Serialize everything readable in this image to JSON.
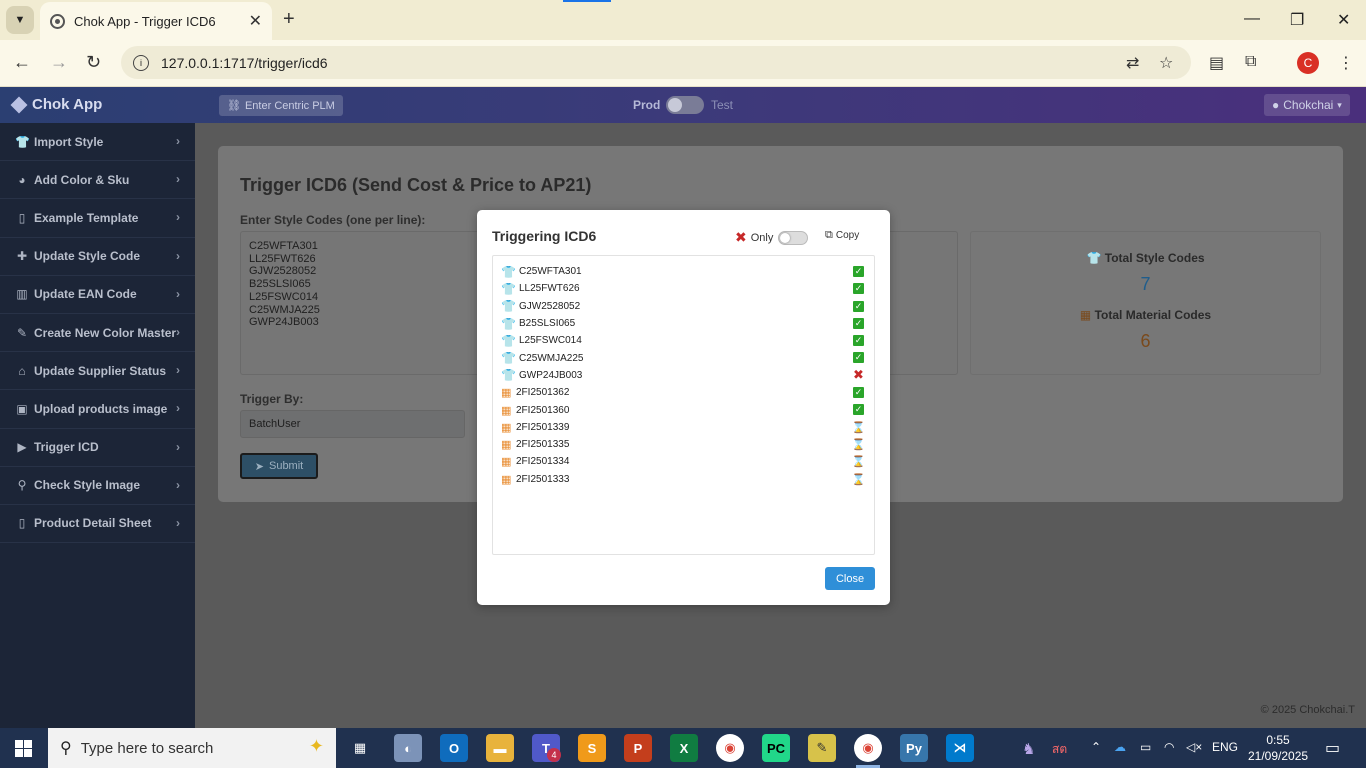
{
  "browser": {
    "tab_title": "Chok App - Trigger ICD6",
    "url": "127.0.0.1:1717/trigger/icd6",
    "profile_initial": "C"
  },
  "appbar": {
    "brand": "Chok App",
    "plm_button": "Enter Centric PLM",
    "env_prod": "Prod",
    "env_test": "Test",
    "user": "Chokchai"
  },
  "sidebar": {
    "items": [
      {
        "label": "Import Style",
        "icon": "shirt-icon"
      },
      {
        "label": "Add Color & Sku",
        "icon": "palette-icon"
      },
      {
        "label": "Example Template",
        "icon": "file-icon"
      },
      {
        "label": "Update Style Code",
        "icon": "puzzle-icon"
      },
      {
        "label": "Update EAN Code",
        "icon": "barcode-icon"
      },
      {
        "label": "Create New Color Master",
        "icon": "brush-icon"
      },
      {
        "label": "Update Supplier Status",
        "icon": "bank-icon"
      },
      {
        "label": "Upload products image",
        "icon": "image-icon"
      },
      {
        "label": "Trigger ICD",
        "icon": "play-circle-icon"
      },
      {
        "label": "Check Style Image",
        "icon": "search-icon"
      },
      {
        "label": "Product Detail Sheet",
        "icon": "file-icon"
      }
    ]
  },
  "main": {
    "title": "Trigger ICD6 (Send Cost & Price to AP21)",
    "codes_label": "Enter Style Codes (one per line):",
    "codes": [
      "C25WFTA301",
      "LL25FWT626",
      "GJW2528052",
      "B25SLSI065",
      "L25FSWC014",
      "C25WMJA225",
      "GWP24JB003"
    ],
    "trigger_by_label": "Trigger By:",
    "trigger_by_value": "BatchUser",
    "submit_label": "Submit",
    "stats": {
      "style_label": "Total Style Codes",
      "style_value": "7",
      "material_label": "Total Material Codes",
      "material_value": "6"
    },
    "footer": "© 2025 Chokchai.T"
  },
  "modal": {
    "title": "Triggering ICD6",
    "only_label": "Only",
    "copy_label": "Copy",
    "close_label": "Close",
    "rows": [
      {
        "code": "C25WFTA301",
        "kind": "style",
        "status": "ok"
      },
      {
        "code": "LL25FWT626",
        "kind": "style",
        "status": "ok"
      },
      {
        "code": "GJW2528052",
        "kind": "style",
        "status": "ok"
      },
      {
        "code": "B25SLSI065",
        "kind": "style",
        "status": "ok"
      },
      {
        "code": "L25FSWC014",
        "kind": "style",
        "status": "ok"
      },
      {
        "code": "C25WMJA225",
        "kind": "style",
        "status": "ok"
      },
      {
        "code": "GWP24JB003",
        "kind": "style",
        "status": "fail"
      },
      {
        "code": "2FI2501362",
        "kind": "material",
        "status": "ok"
      },
      {
        "code": "2FI2501360",
        "kind": "material",
        "status": "ok"
      },
      {
        "code": "2FI2501339",
        "kind": "material",
        "status": "pending"
      },
      {
        "code": "2FI2501335",
        "kind": "material",
        "status": "pending"
      },
      {
        "code": "2FI2501334",
        "kind": "material",
        "status": "pending"
      },
      {
        "code": "2FI2501333",
        "kind": "material",
        "status": "pending"
      }
    ]
  },
  "taskbar": {
    "search_placeholder": "Type here to search",
    "teams_badge": "4",
    "ime": "สต",
    "lang": "ENG",
    "time": "0:55",
    "date": "21/09/2025"
  },
  "colors": {
    "sidebar_bg": "#1c2537",
    "accent_blue": "#2f8fd8",
    "material_orange": "#e88b2f",
    "ok_green": "#2aa52a",
    "fail_red": "#c62828"
  }
}
